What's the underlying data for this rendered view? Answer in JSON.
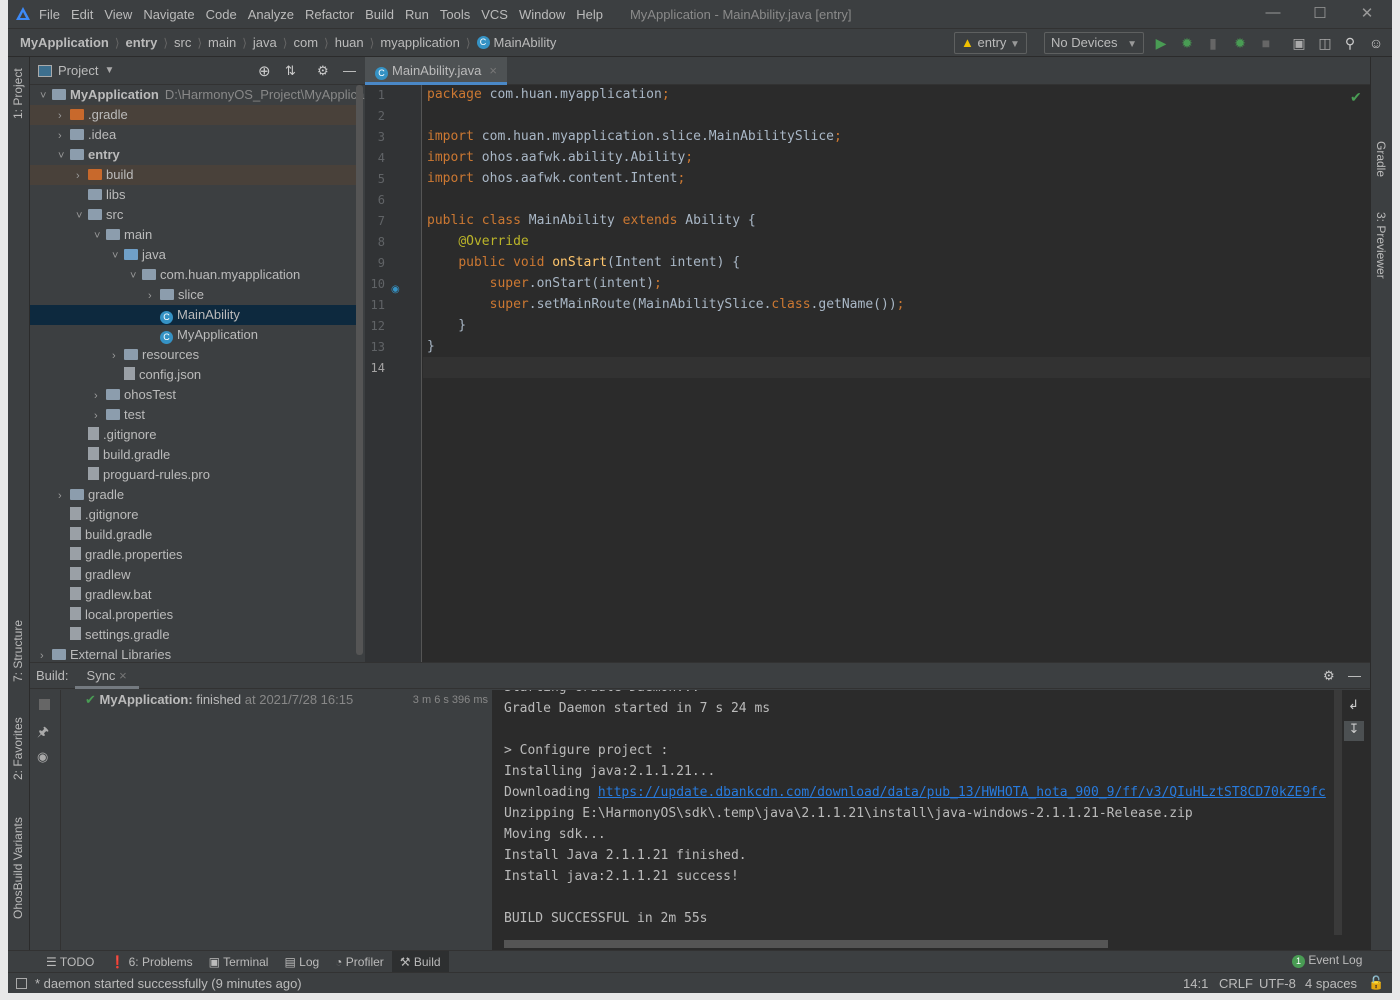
{
  "window": {
    "title": "MyApplication - MainAbility.java [entry]",
    "menu": [
      "File",
      "Edit",
      "View",
      "Navigate",
      "Code",
      "Analyze",
      "Refactor",
      "Build",
      "Run",
      "Tools",
      "VCS",
      "Window",
      "Help"
    ]
  },
  "breadcrumb": [
    "MyApplication",
    "entry",
    "src",
    "main",
    "java",
    "com",
    "huan",
    "myapplication",
    "MainAbility"
  ],
  "toolbar": {
    "run_config": "entry",
    "device": "No Devices"
  },
  "left_tabs": {
    "project": "1: Project",
    "structure": "7: Structure",
    "favorites": "2: Favorites",
    "variants": "OhosBuild Variants"
  },
  "right_tabs": {
    "gradle": "Gradle",
    "previewer": "3: Previewer"
  },
  "project": {
    "header": "Project",
    "root_path": "D:\\HarmonyOS_Project\\MyApplica",
    "tree": [
      {
        "label": "MyApplication",
        "depth": 0,
        "arrow": "open",
        "icon": "module",
        "bold": true
      },
      {
        "label": ".gradle",
        "depth": 1,
        "arrow": "closed",
        "icon": "folder-orange",
        "state": "excluded"
      },
      {
        "label": ".idea",
        "depth": 1,
        "arrow": "closed",
        "icon": "folder"
      },
      {
        "label": "entry",
        "depth": 1,
        "arrow": "open",
        "icon": "folder-module",
        "bold": true
      },
      {
        "label": "build",
        "depth": 2,
        "arrow": "closed",
        "icon": "folder-orange",
        "state": "excluded"
      },
      {
        "label": "libs",
        "depth": 2,
        "arrow": "none",
        "icon": "folder"
      },
      {
        "label": "src",
        "depth": 2,
        "arrow": "open",
        "icon": "folder"
      },
      {
        "label": "main",
        "depth": 3,
        "arrow": "open",
        "icon": "folder"
      },
      {
        "label": "java",
        "depth": 4,
        "arrow": "open",
        "icon": "folder-blue"
      },
      {
        "label": "com.huan.myapplication",
        "depth": 5,
        "arrow": "open",
        "icon": "package"
      },
      {
        "label": "slice",
        "depth": 6,
        "arrow": "closed",
        "icon": "package"
      },
      {
        "label": "MainAbility",
        "depth": 6,
        "arrow": "none",
        "icon": "class",
        "state": "selected"
      },
      {
        "label": "MyApplication",
        "depth": 6,
        "arrow": "none",
        "icon": "class"
      },
      {
        "label": "resources",
        "depth": 4,
        "arrow": "closed",
        "icon": "folder-res"
      },
      {
        "label": "config.json",
        "depth": 4,
        "arrow": "none",
        "icon": "json-file"
      },
      {
        "label": "ohosTest",
        "depth": 3,
        "arrow": "closed",
        "icon": "folder"
      },
      {
        "label": "test",
        "depth": 3,
        "arrow": "closed",
        "icon": "folder"
      },
      {
        "label": ".gitignore",
        "depth": 2,
        "arrow": "none",
        "icon": "file"
      },
      {
        "label": "build.gradle",
        "depth": 2,
        "arrow": "none",
        "icon": "gradle-file"
      },
      {
        "label": "proguard-rules.pro",
        "depth": 2,
        "arrow": "none",
        "icon": "file"
      },
      {
        "label": "gradle",
        "depth": 1,
        "arrow": "closed",
        "icon": "folder"
      },
      {
        "label": ".gitignore",
        "depth": 1,
        "arrow": "none",
        "icon": "file"
      },
      {
        "label": "build.gradle",
        "depth": 1,
        "arrow": "none",
        "icon": "gradle-file"
      },
      {
        "label": "gradle.properties",
        "depth": 1,
        "arrow": "none",
        "icon": "file"
      },
      {
        "label": "gradlew",
        "depth": 1,
        "arrow": "none",
        "icon": "file"
      },
      {
        "label": "gradlew.bat",
        "depth": 1,
        "arrow": "none",
        "icon": "file"
      },
      {
        "label": "local.properties",
        "depth": 1,
        "arrow": "none",
        "icon": "file"
      },
      {
        "label": "settings.gradle",
        "depth": 1,
        "arrow": "none",
        "icon": "gradle-file"
      },
      {
        "label": "External Libraries",
        "depth": 0,
        "arrow": "closed",
        "icon": "libraries"
      }
    ]
  },
  "editor": {
    "tab": "MainAbility.java",
    "current_line": 14,
    "lines": [
      [
        [
          "kw",
          "package "
        ],
        [
          "pl",
          "com.huan.myapplication"
        ],
        [
          "kw",
          ";"
        ]
      ],
      [],
      [
        [
          "kw",
          "import "
        ],
        [
          "pl",
          "com.huan.myapplication.slice.MainAbilitySlice"
        ],
        [
          "kw",
          ";"
        ]
      ],
      [
        [
          "kw",
          "import "
        ],
        [
          "pl",
          "ohos.aafwk.ability.Ability"
        ],
        [
          "kw",
          ";"
        ]
      ],
      [
        [
          "kw",
          "import "
        ],
        [
          "pl",
          "ohos.aafwk.content.Intent"
        ],
        [
          "kw",
          ";"
        ]
      ],
      [],
      [
        [
          "kw",
          "public class "
        ],
        [
          "pl",
          "MainAbility "
        ],
        [
          "kw",
          "extends "
        ],
        [
          "pl",
          "Ability {"
        ]
      ],
      [
        [
          "pl",
          "    "
        ],
        [
          "an",
          "@Override"
        ]
      ],
      [
        [
          "pl",
          "    "
        ],
        [
          "kw",
          "public void "
        ],
        [
          "fn",
          "onStart"
        ],
        [
          "pl",
          "(Intent intent) {"
        ]
      ],
      [
        [
          "pl",
          "        "
        ],
        [
          "kw",
          "super"
        ],
        [
          "pl",
          ".onStart(intent)"
        ],
        [
          "kw",
          ";"
        ]
      ],
      [
        [
          "pl",
          "        "
        ],
        [
          "kw",
          "super"
        ],
        [
          "pl",
          ".setMainRoute(MainAbilitySlice."
        ],
        [
          "kw",
          "class"
        ],
        [
          "pl",
          ".getName())"
        ],
        [
          "kw",
          ";"
        ]
      ],
      [
        [
          "pl",
          "    }"
        ]
      ],
      [
        [
          "pl",
          "}"
        ]
      ],
      []
    ]
  },
  "build": {
    "label": "Build:",
    "tab": "Sync",
    "result_name": "MyApplication:",
    "result_status": "finished",
    "result_time": "at 2021/7/28 16:15",
    "duration": "3 m 6 s 396 ms",
    "console": [
      "Starting Gradle Daemon...",
      "Gradle Daemon started in 7 s 24 ms",
      "",
      "> Configure project :",
      "Installing java:2.1.1.21...",
      "Downloading ",
      "Unzipping E:\\HarmonyOS\\sdk\\.temp\\java\\2.1.1.21\\install\\java-windows-2.1.1.21-Release.zip",
      "Moving sdk...",
      "Install Java 2.1.1.21 finished.",
      "Install java:2.1.1.21 success!",
      "",
      "BUILD SUCCESSFUL in 2m 55s"
    ],
    "download_url": "https://update.dbankcdn.com/download/data/pub_13/HWHOTA_hota_900_9/ff/v3/QIuHLztST8CD70kZE9fc"
  },
  "tool_windows": [
    "TODO",
    "6: Problems",
    "Terminal",
    "Log",
    "Profiler",
    "Build"
  ],
  "event_log": {
    "label": "Event Log",
    "count": "1"
  },
  "status": {
    "message": "* daemon started successfully (9 minutes ago)",
    "position": "14:1",
    "line_sep": "CRLF",
    "encoding": "UTF-8",
    "indent": "4 spaces"
  },
  "colors": {
    "accent": "#4a88c7",
    "success": "#499c54",
    "keyword": "#cc7832",
    "link": "#287bde"
  }
}
